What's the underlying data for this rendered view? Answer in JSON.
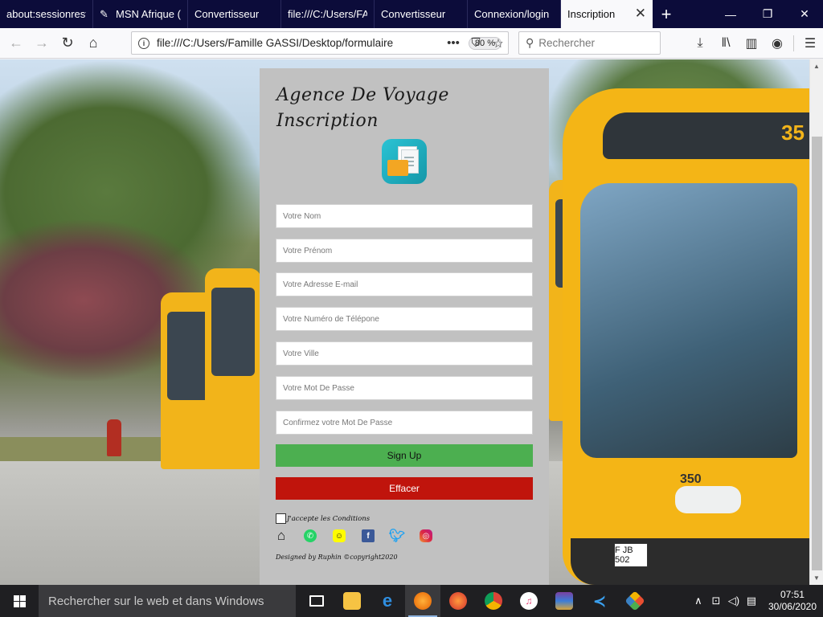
{
  "browser": {
    "tabs": [
      {
        "label": "about:sessionrestore",
        "icon": "blank-icon",
        "active": false
      },
      {
        "label": "MSN Afrique (",
        "icon": "msn-icon",
        "active": false
      },
      {
        "label": "Convertisseur",
        "icon": "blank-icon",
        "active": false
      },
      {
        "label": "file:///C:/Users/FA",
        "icon": "blank-icon",
        "active": false
      },
      {
        "label": "Convertisseur",
        "icon": "blank-icon",
        "active": false
      },
      {
        "label": "Connexion/login",
        "icon": "blank-icon",
        "active": false
      },
      {
        "label": "Inscription",
        "icon": "blank-icon",
        "active": true
      }
    ],
    "url": "file:///C:/Users/Famille GASSI/Desktop/formulaire",
    "zoom": "80 %",
    "search_placeholder": "Rechercher"
  },
  "form": {
    "title_line1": "Agence De Voyage",
    "title_line2": "Inscription",
    "fields": [
      {
        "placeholder": "Votre Nom"
      },
      {
        "placeholder": "Votre Prénom"
      },
      {
        "placeholder": "Votre Adresse E-mail"
      },
      {
        "placeholder": "Votre Numéro de Télépone"
      },
      {
        "placeholder": "Votre Ville"
      },
      {
        "placeholder": "Votre Mot De Passe"
      },
      {
        "placeholder": "Confirmez votre Mot De Passe"
      }
    ],
    "signup_label": "Sign Up",
    "reset_label": "Effacer",
    "terms_label": "J'accepte les Conditions",
    "credits": "Designed by Ruphin ©copyright2020",
    "signup_color": "#4caf50",
    "reset_color": "#c0140c",
    "panel_color": "#c1c1c1"
  },
  "background": {
    "bus_number": "35",
    "bus_side_number": "350",
    "plate": "F JB 502"
  },
  "taskbar": {
    "search_placeholder": "Rechercher sur le web et dans Windows",
    "time": "07:51",
    "date": "30/06/2020"
  }
}
